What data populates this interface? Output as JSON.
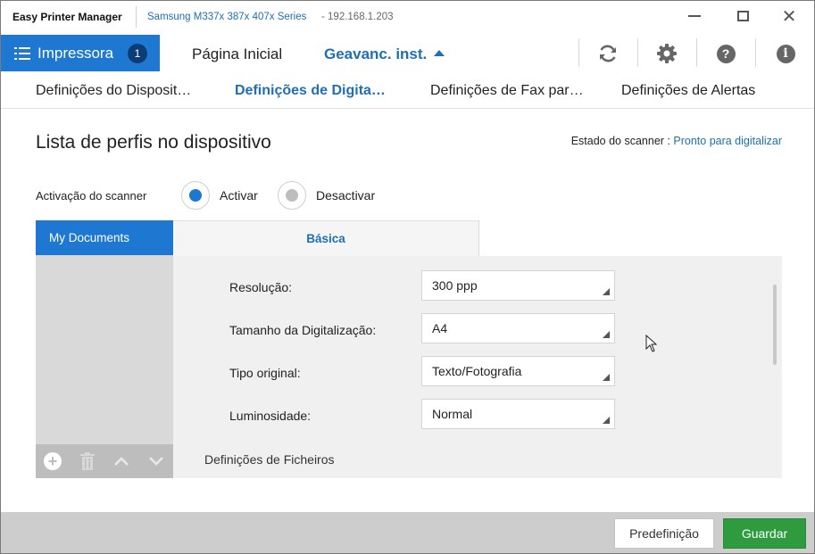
{
  "window": {
    "app_title": "Easy Printer Manager",
    "device_name": "Samsung M337x 387x 407x Series",
    "device_ip": "- 192.168.1.203",
    "minimize_label": "Minimize",
    "maximize_label": "Maximize",
    "close_label": "Close"
  },
  "nav": {
    "printer_label": "Impressora",
    "printer_count": "1",
    "home_label": "Página Inicial",
    "advanced_label": "Geavanc. inst.",
    "icons": [
      "refresh-icon",
      "gear-icon",
      "help-icon",
      "info-icon"
    ]
  },
  "subtabs": [
    {
      "label": "Definições do Disposit…"
    },
    {
      "label": "Definições de Digita…",
      "active": true
    },
    {
      "label": "Definições de Fax par…"
    },
    {
      "label": "Definições de Alertas"
    }
  ],
  "content": {
    "title": "Lista de perfis no dispositivo",
    "scanner_status_label": "Estado do scanner :",
    "scanner_status_value": "Pronto para digitalizar",
    "activation_label": "Activação do scanner",
    "activate_label": "Activar",
    "deactivate_label": "Desactivar",
    "activation_selected": "Activar"
  },
  "profiles": {
    "items": [
      "My Documents"
    ],
    "selected": "My Documents",
    "toolbar_icons": [
      "add-icon",
      "trash-icon",
      "up-arrow-icon",
      "down-arrow-icon"
    ]
  },
  "settings": {
    "tab_label": "Básica",
    "fields": [
      {
        "label": "Resolução:",
        "value": "300 ppp"
      },
      {
        "label": "Tamanho da Digitalização:",
        "value": "A4"
      },
      {
        "label": "Tipo original:",
        "value": "Texto/Fotografia"
      },
      {
        "label": "Luminosidade:",
        "value": "Normal"
      }
    ],
    "files_heading": "Definições de Ficheiros"
  },
  "footer": {
    "default_label": "Predefinição",
    "save_label": "Guardar"
  },
  "colors": {
    "accent": "#1e78d2",
    "link": "#1e6fb5",
    "save": "#2e9c3e",
    "badge": "#0a3d78"
  }
}
